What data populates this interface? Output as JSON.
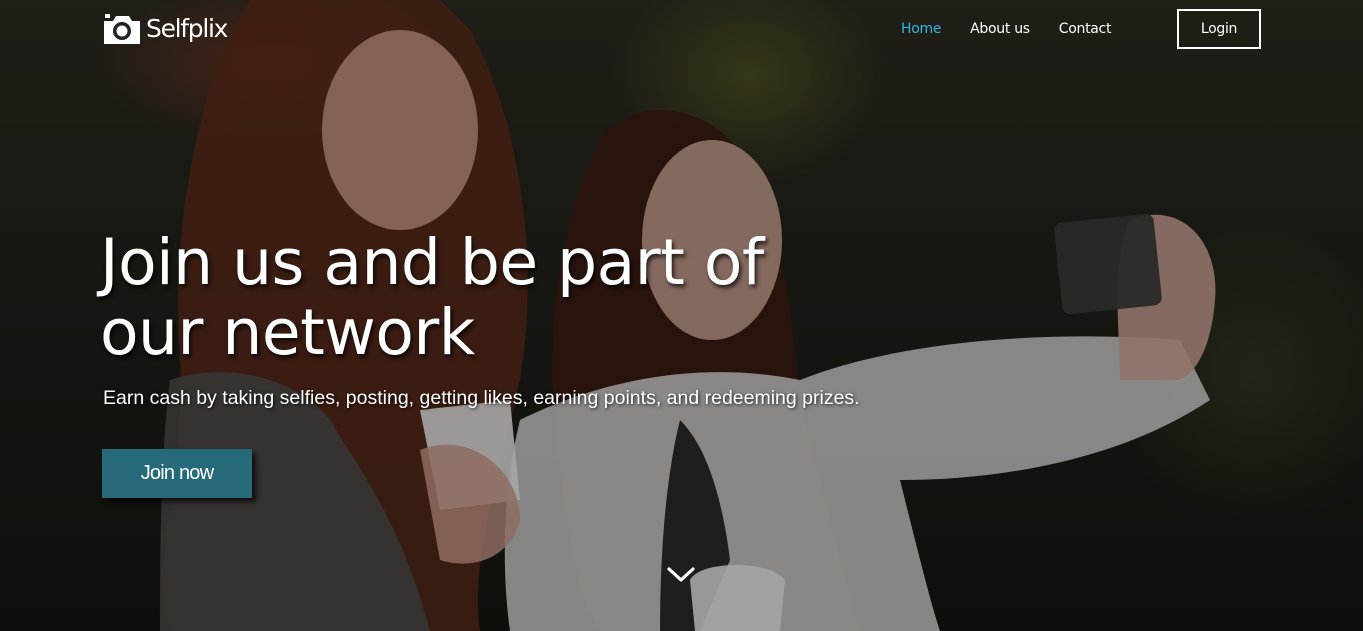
{
  "brand": {
    "name": "Selfplix",
    "logo_icon": "camera-icon"
  },
  "nav": {
    "links": [
      {
        "label": "Home",
        "active": true
      },
      {
        "label": "About us",
        "active": false
      },
      {
        "label": "Contact",
        "active": false
      }
    ],
    "login_label": "Login"
  },
  "hero": {
    "headline_line1": "Join us and be part of",
    "headline_line2": "our network",
    "subheadline": "Earn cash by taking selfies, posting, getting likes, earning points, and redeeming prizes.",
    "cta_label": "Join now",
    "scroll_icon": "chevron-down-icon"
  },
  "colors": {
    "accent_nav_active": "#2fb6e0",
    "cta_background": "#266a7a",
    "text": "#ffffff"
  }
}
